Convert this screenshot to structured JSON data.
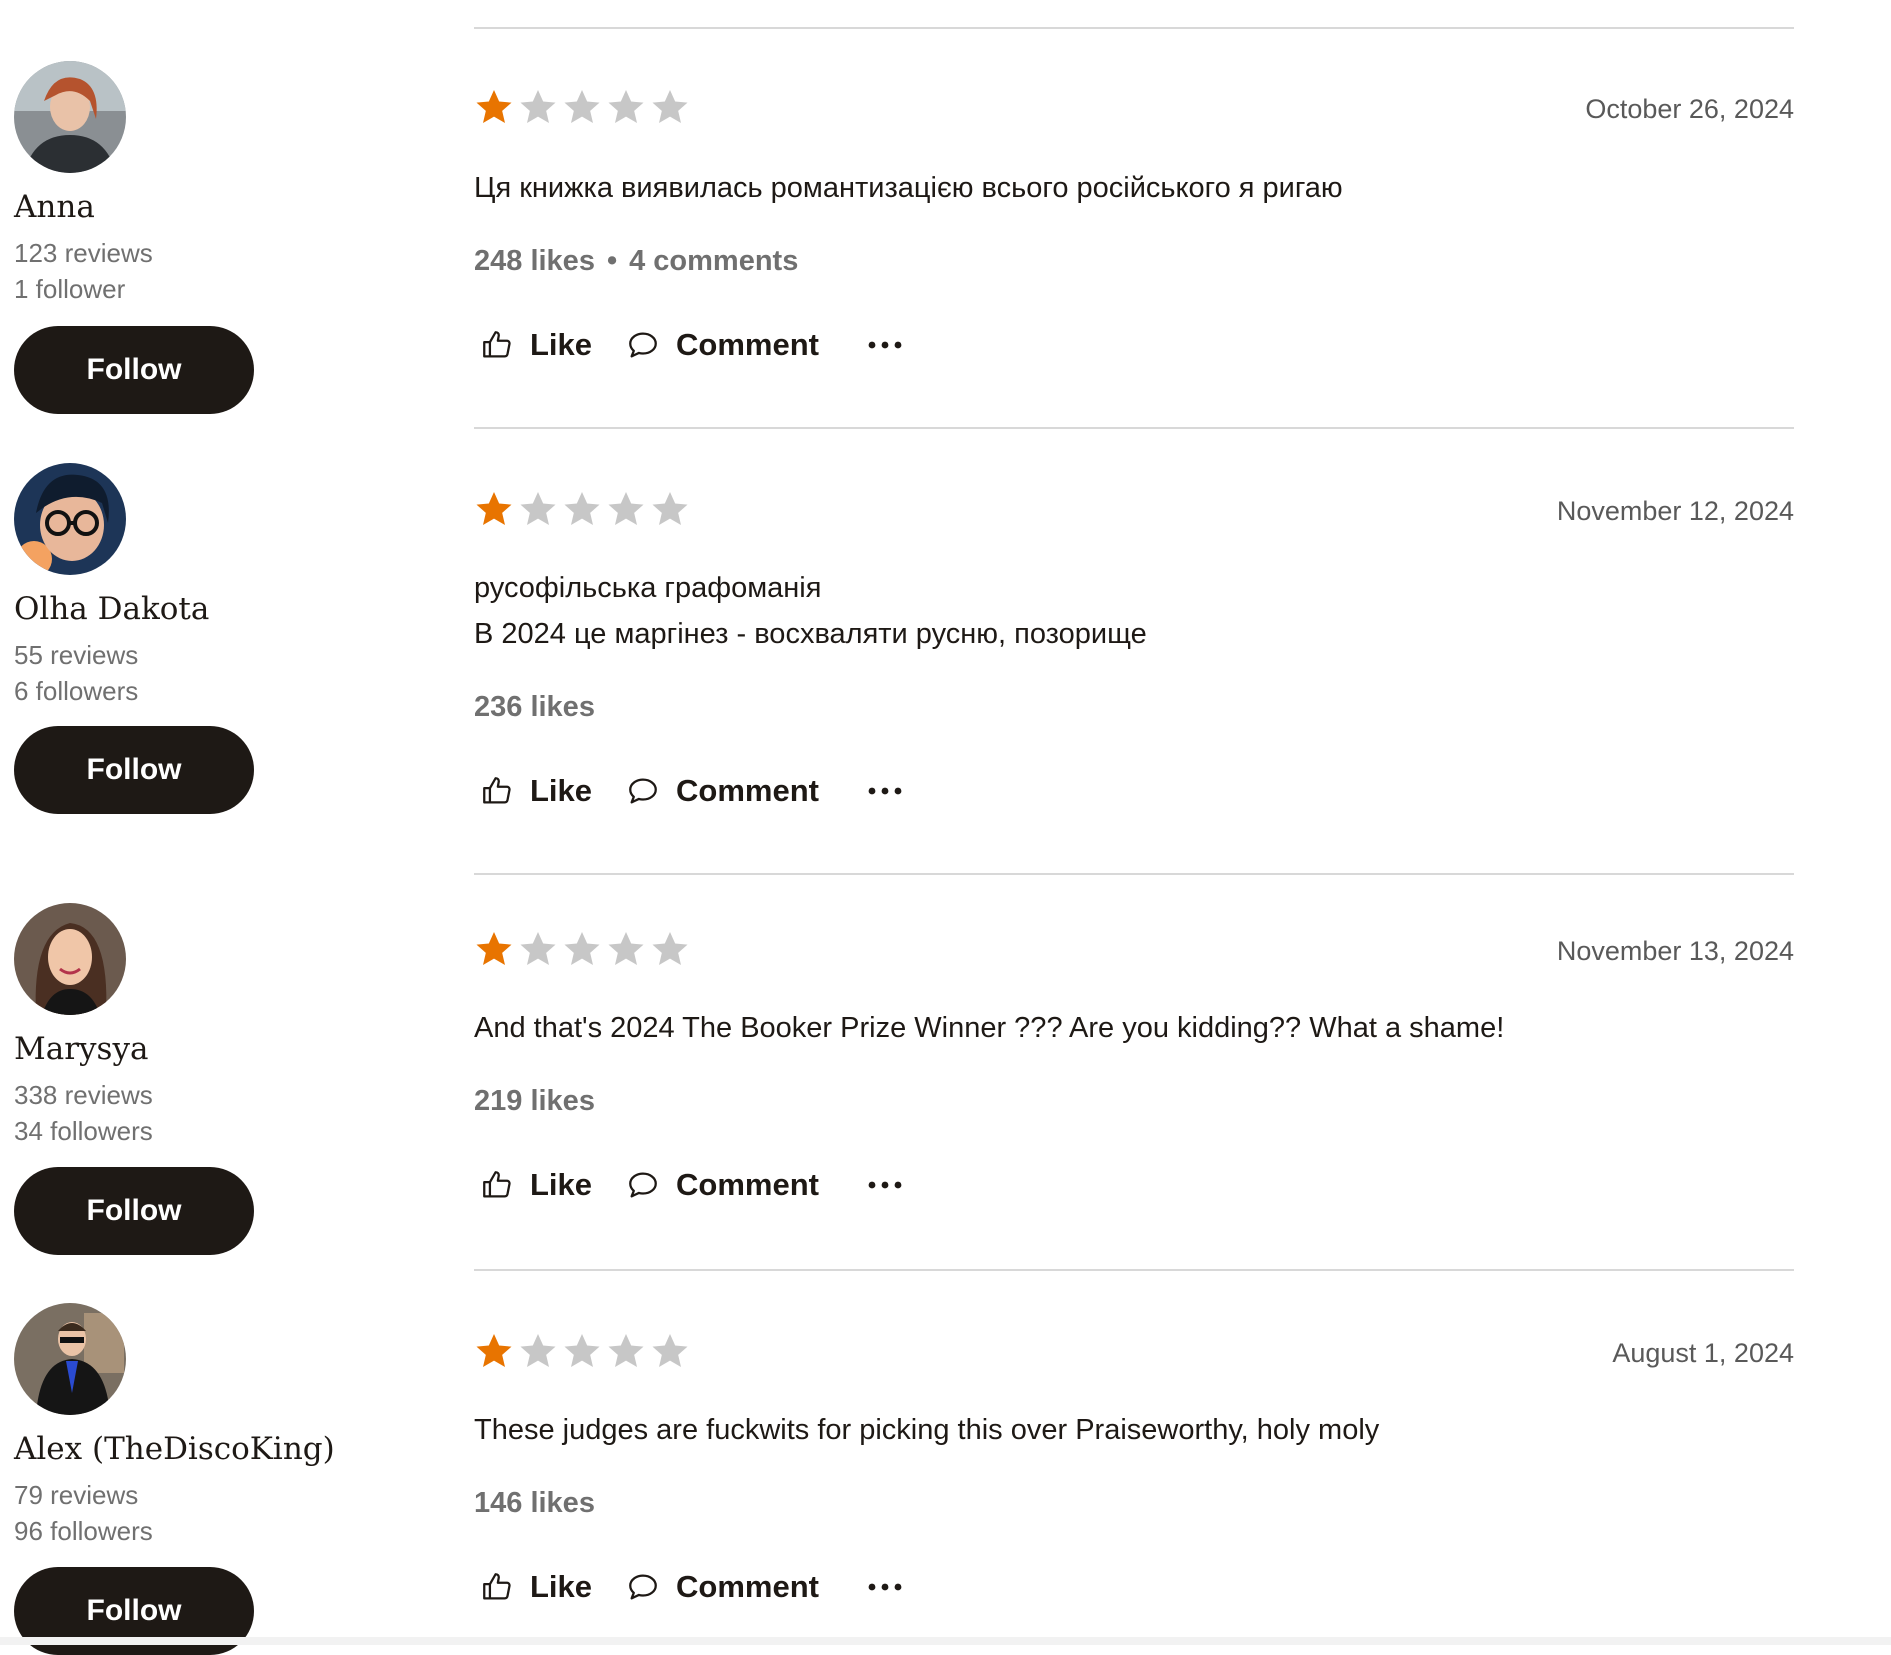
{
  "reviews": [
    {
      "reviewer": {
        "name": "Anna",
        "reviews": "123 reviews",
        "followers": "1 follower"
      },
      "follow_label": "Follow",
      "rating": 1,
      "max_rating": 5,
      "date": "October 26, 2024",
      "text": [
        "Ця книжка виявилась романтизацією всього російського я ригаю"
      ],
      "likes": "248 likes",
      "comments": "4 comments",
      "like_label": "Like",
      "comment_label": "Comment"
    },
    {
      "reviewer": {
        "name": "Olha Dakota",
        "reviews": "55 reviews",
        "followers": "6 followers"
      },
      "follow_label": "Follow",
      "rating": 1,
      "max_rating": 5,
      "date": "November 12, 2024",
      "text": [
        "русофільська графоманія",
        "В 2024 це маргінез - восхваляти русню, позорище"
      ],
      "likes": "236 likes",
      "like_label": "Like",
      "comment_label": "Comment"
    },
    {
      "reviewer": {
        "name": "Marysya",
        "reviews": "338 reviews",
        "followers": "34 followers"
      },
      "follow_label": "Follow",
      "rating": 1,
      "max_rating": 5,
      "date": "November 13, 2024",
      "text": [
        "And that's 2024 The Booker Prize Winner ??? Are you kidding?? What a shame!"
      ],
      "likes": "219 likes",
      "like_label": "Like",
      "comment_label": "Comment"
    },
    {
      "reviewer": {
        "name": "Alex (TheDiscoKing)",
        "reviews": "79 reviews",
        "followers": "96 followers"
      },
      "follow_label": "Follow",
      "rating": 1,
      "max_rating": 5,
      "date": "August 1, 2024",
      "text": [
        "These judges are fuckwits for picking this over Praiseworthy, holy moly"
      ],
      "likes": "146 likes",
      "like_label": "Like",
      "comment_label": "Comment"
    }
  ],
  "colors": {
    "star_filled": "#e87400",
    "star_empty": "#c7c7c7",
    "button_bg": "#1e1915",
    "muted_text": "#707070",
    "divider": "#d8d8d8"
  },
  "icons": {
    "like": "thumbs-up-icon",
    "comment": "speech-bubble-icon",
    "more": "ellipsis-icon",
    "star": "star-icon"
  }
}
